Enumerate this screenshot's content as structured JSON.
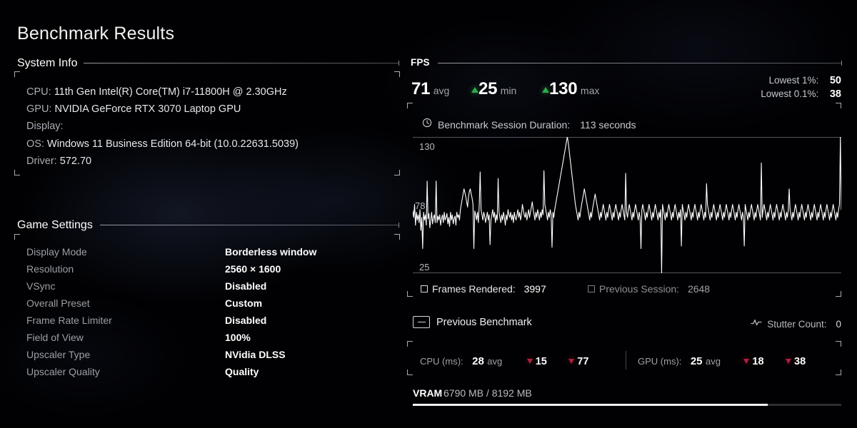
{
  "page_title": "Benchmark Results",
  "system_info": {
    "heading": "System Info",
    "rows": [
      {
        "label": "CPU:",
        "value": "11th Gen Intel(R) Core(TM) i7-11800H @ 2.30GHz"
      },
      {
        "label": "GPU:",
        "value": "NVIDIA GeForce RTX 3070 Laptop GPU"
      },
      {
        "label": "Display:",
        "value": ""
      },
      {
        "label": "OS:",
        "value": "Windows 11 Business Edition 64-bit (10.0.22631.5039)"
      },
      {
        "label": "Driver:",
        "value": "572.70"
      }
    ]
  },
  "game_settings": {
    "heading": "Game Settings",
    "rows": [
      {
        "label": "Display Mode",
        "value": "Borderless window"
      },
      {
        "label": "Resolution",
        "value": "2560 × 1600"
      },
      {
        "label": "VSync",
        "value": "Disabled"
      },
      {
        "label": "Overall Preset",
        "value": "Custom"
      },
      {
        "label": "Frame Rate Limiter",
        "value": "Disabled"
      },
      {
        "label": "Field of View",
        "value": "100%"
      },
      {
        "label": "Upscaler Type",
        "value": "NVidia DLSS"
      },
      {
        "label": "Upscaler Quality",
        "value": "Quality"
      }
    ]
  },
  "fps": {
    "heading": "FPS",
    "avg": "71",
    "avg_label": "avg",
    "min": "25",
    "min_label": "min",
    "max": "130",
    "max_label": "max",
    "lowest_1_label": "Lowest 1%:",
    "lowest_1_value": "50",
    "lowest_01_label": "Lowest 0.1%:",
    "lowest_01_value": "38",
    "duration_label": "Benchmark Session Duration:",
    "duration_value": "113 seconds",
    "axis_top": "130",
    "axis_mid": "78",
    "axis_bottom": "25"
  },
  "frames": {
    "rendered_label": "Frames Rendered:",
    "rendered_value": "3997",
    "previous_label": "Previous Session:",
    "previous_value": "2648"
  },
  "previous_benchmark": {
    "label": "Previous Benchmark",
    "key_icon": "keycap-dash-icon"
  },
  "stutter": {
    "label": "Stutter Count:",
    "value": "0",
    "icon": "activity-wave-icon"
  },
  "timings": {
    "cpu": {
      "label": "CPU (ms):",
      "avg": "28",
      "avg_suffix": "avg",
      "min": "15",
      "max": "77"
    },
    "gpu": {
      "label": "GPU (ms):",
      "avg": "25",
      "avg_suffix": "avg",
      "min": "18",
      "max": "38"
    }
  },
  "vram": {
    "title": "VRAM",
    "detail": "6790 MB / 8192 MB",
    "used_mb": 6790,
    "total_mb": 8192,
    "percent": 82.9
  },
  "colors": {
    "background": "#010103",
    "text_primary": "#ffffff",
    "text_muted": "#9b9fa6",
    "good_indicator": "#2faa4a",
    "bad_indicator": "#b0203c",
    "rule": "#bec3cd",
    "graph_line": "#ffffff"
  },
  "chart_data": {
    "type": "line",
    "title": "FPS",
    "xlabel": "",
    "ylabel": "FPS",
    "ylim": [
      25,
      130
    ],
    "yticks": [
      25,
      78,
      130
    ],
    "grid": false,
    "legend": "none",
    "series": [
      {
        "name": "FPS over time",
        "values": [
          73,
          68,
          78,
          62,
          72,
          66,
          70,
          64,
          74,
          58,
          68,
          44,
          72,
          66,
          70,
          62,
          96,
          67,
          71,
          60,
          66,
          72,
          63,
          68,
          70,
          64,
          96,
          64,
          69,
          66,
          70,
          62,
          67,
          70,
          64,
          72,
          66,
          68,
          71,
          63,
          68,
          61,
          72,
          66,
          70,
          63,
          67,
          69,
          62,
          72,
          68,
          70,
          66,
          74,
          78,
          82,
          86,
          90,
          87,
          84,
          80,
          76,
          84,
          88,
          90,
          86,
          83,
          78,
          44,
          73,
          70,
          66,
          72,
          64,
          78,
          103,
          74,
          70,
          66,
          72,
          69,
          64,
          68,
          72,
          66,
          70,
          47,
          66,
          70,
          74,
          68,
          72,
          64,
          70,
          66,
          98,
          72,
          68,
          64,
          70,
          66,
          72,
          68,
          62,
          70,
          66,
          74,
          70,
          68,
          72,
          66,
          70,
          64,
          72,
          68,
          66,
          70,
          74,
          68,
          72,
          66,
          70,
          78,
          74,
          70,
          68,
          72,
          66,
          70,
          74,
          68,
          72,
          76,
          80,
          74,
          70,
          66,
          72,
          68,
          74,
          70,
          66,
          72,
          68,
          74,
          70,
          104,
          78,
          74,
          70,
          66,
          72,
          68,
          74,
          70,
          45,
          72,
          68,
          74,
          78,
          82,
          86,
          90,
          94,
          98,
          102,
          106,
          110,
          114,
          118,
          122,
          126,
          130,
          126,
          120,
          114,
          108,
          102,
          96,
          90,
          84,
          78,
          74,
          70,
          66,
          72,
          68,
          74,
          78,
          82,
          86,
          90,
          86,
          82,
          78,
          74,
          70,
          66,
          72,
          68,
          74,
          78,
          82,
          86,
          82,
          78,
          74,
          70,
          66,
          72,
          68,
          74,
          78,
          74,
          70,
          66,
          72,
          68,
          74,
          78,
          74,
          70,
          66,
          72,
          68,
          74,
          78,
          74,
          70,
          66,
          72,
          68,
          74,
          78,
          74,
          70,
          66,
          102,
          72,
          68,
          74,
          78,
          74,
          70,
          66,
          72,
          68,
          74,
          78,
          74,
          70,
          66,
          72,
          68,
          44,
          74,
          78,
          74,
          70,
          66,
          72,
          68,
          74,
          78,
          74,
          70,
          66,
          72,
          68,
          74,
          78,
          74,
          70,
          66,
          72,
          68,
          74,
          25,
          78,
          74,
          70,
          66,
          72,
          68,
          74,
          78,
          74,
          70,
          66,
          72,
          68,
          74,
          78,
          74,
          70,
          66,
          72,
          68,
          74,
          46,
          78,
          74,
          70,
          66,
          72,
          68,
          74,
          78,
          74,
          70,
          66,
          72,
          68,
          74,
          78,
          74,
          70,
          66,
          72,
          68,
          74,
          78,
          74,
          70,
          66,
          72,
          68,
          94,
          78,
          74,
          70,
          66,
          72,
          68,
          74,
          78,
          74,
          70,
          66,
          72,
          68,
          74,
          78,
          74,
          70,
          66,
          72,
          68,
          74,
          78,
          74,
          70,
          66,
          72,
          68,
          74,
          78,
          74,
          70,
          66,
          72,
          68,
          74,
          78,
          74,
          70,
          66,
          72,
          68,
          46,
          78,
          74,
          70,
          66,
          72,
          68,
          74,
          78,
          74,
          70,
          66,
          72,
          68,
          74,
          78,
          74,
          70,
          66,
          110,
          68,
          74,
          78,
          74,
          70,
          66,
          72,
          68,
          74,
          78,
          74,
          70,
          66,
          72,
          68,
          74,
          78,
          74,
          70,
          66,
          72,
          68,
          74,
          78,
          74,
          70,
          66,
          72,
          68,
          74,
          90,
          74,
          70,
          66,
          72,
          68,
          74,
          78,
          74,
          70,
          66,
          72,
          68,
          74,
          78,
          74,
          70,
          66,
          72,
          68,
          74,
          78,
          74,
          70,
          66,
          72,
          68,
          74,
          78,
          74,
          70,
          66,
          72,
          68,
          74,
          78,
          74,
          70,
          66,
          72,
          68,
          74,
          78,
          74,
          70,
          66,
          72,
          68,
          74,
          78,
          74,
          70,
          66,
          72,
          68,
          74,
          78,
          130,
          74
        ]
      }
    ]
  }
}
